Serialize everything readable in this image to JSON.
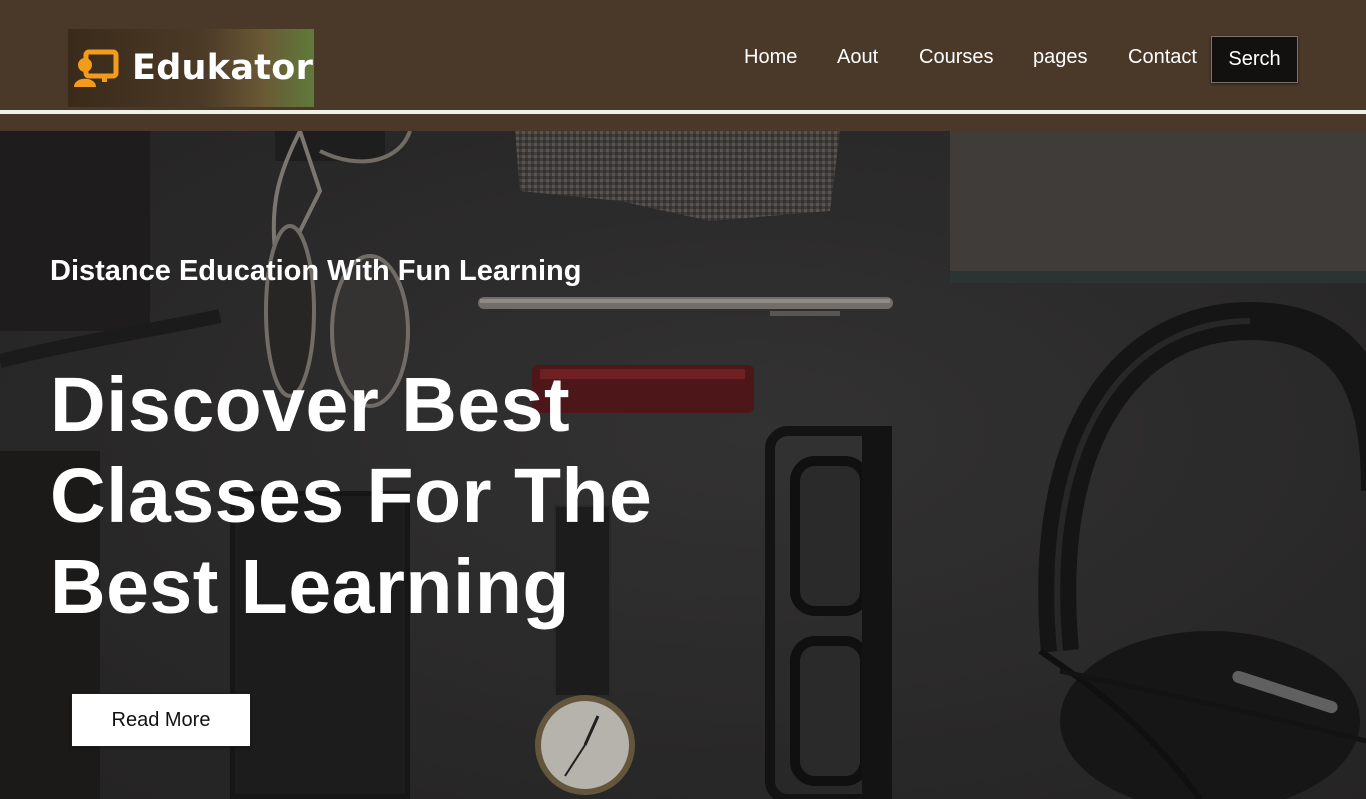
{
  "brand": {
    "name": "Edukator",
    "logo_icon": "presentation-user-icon",
    "accent_color": "#f39c1b"
  },
  "nav": {
    "items": [
      {
        "label": "Home"
      },
      {
        "label": "Aout"
      },
      {
        "label": "Courses"
      },
      {
        "label": "pages"
      },
      {
        "label": "Contact"
      }
    ],
    "search_label": "Serch"
  },
  "hero": {
    "subtitle": "Distance Education With Fun Learning",
    "headline_lines": [
      "Discover Best",
      "Classes For The",
      "Best Learning"
    ],
    "cta_label": "Read More"
  },
  "colors": {
    "header_bg": "#4a3828",
    "hero_bg": "#2d2d2d",
    "text": "#ffffff"
  }
}
